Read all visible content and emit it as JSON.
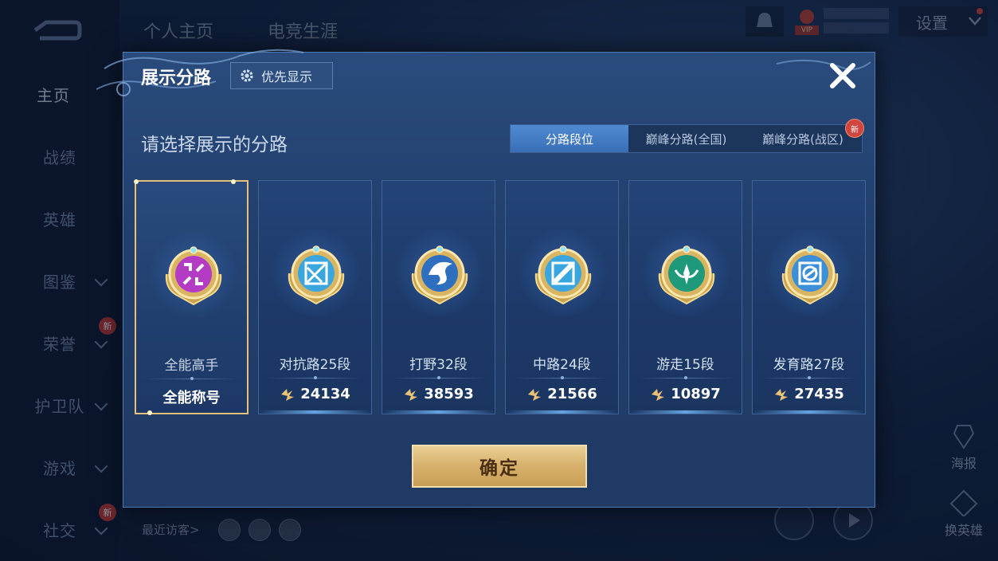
{
  "background": {
    "sidebar_items": [
      {
        "label": "主页",
        "active": true
      },
      {
        "label": "战绩"
      },
      {
        "label": "英雄"
      },
      {
        "label": "图鉴",
        "chevron": true
      },
      {
        "label": "荣誉",
        "chevron": true,
        "new": true
      },
      {
        "label": "护卫队",
        "chevron": true
      },
      {
        "label": "游戏",
        "chevron": true
      },
      {
        "label": "社交",
        "chevron": true,
        "new": true
      }
    ],
    "new_badge": "新",
    "top_tabs": [
      "个人主页",
      "电竞生涯"
    ],
    "settings_label": "设置",
    "vip_label": "VIP",
    "right_buttons": [
      "海报",
      "换英雄"
    ],
    "visitor_label": "最近访客>"
  },
  "dialog": {
    "title": "展示分路",
    "priority_button": "优先显示",
    "subtitle": "请选择展示的分路",
    "tabs": [
      {
        "label": "分路段位",
        "active": true
      },
      {
        "label": "巅峰分路(全国)",
        "active": false
      },
      {
        "label": "巅峰分路(战区)",
        "active": false,
        "new": true
      }
    ],
    "tab_new_badge": "新",
    "cards": [
      {
        "title": "全能高手",
        "value": "全能称号",
        "emblem": "all-round-emblem-icon",
        "color": "#b43bc3",
        "selected": true,
        "show_power_icon": false
      },
      {
        "title": "对抗路25段",
        "value": "24134",
        "emblem": "clash-lane-emblem-icon",
        "color": "#3aa6df",
        "selected": false,
        "show_power_icon": true
      },
      {
        "title": "打野32段",
        "value": "38593",
        "emblem": "jungle-emblem-icon",
        "color": "#2f6fbf",
        "selected": false,
        "show_power_icon": true
      },
      {
        "title": "中路24段",
        "value": "21566",
        "emblem": "mid-lane-emblem-icon",
        "color": "#3aa6df",
        "selected": false,
        "show_power_icon": true
      },
      {
        "title": "游走15段",
        "value": "10897",
        "emblem": "roam-emblem-icon",
        "color": "#1e9a7a",
        "selected": false,
        "show_power_icon": true
      },
      {
        "title": "发育路27段",
        "value": "27435",
        "emblem": "farm-lane-emblem-icon",
        "color": "#3a8fd8",
        "selected": false,
        "show_power_icon": true
      }
    ],
    "confirm_label": "确定",
    "colors": {
      "gold": "#e5c27a",
      "accent_blue": "#3a6fb6",
      "panel": "#223f6c"
    }
  }
}
